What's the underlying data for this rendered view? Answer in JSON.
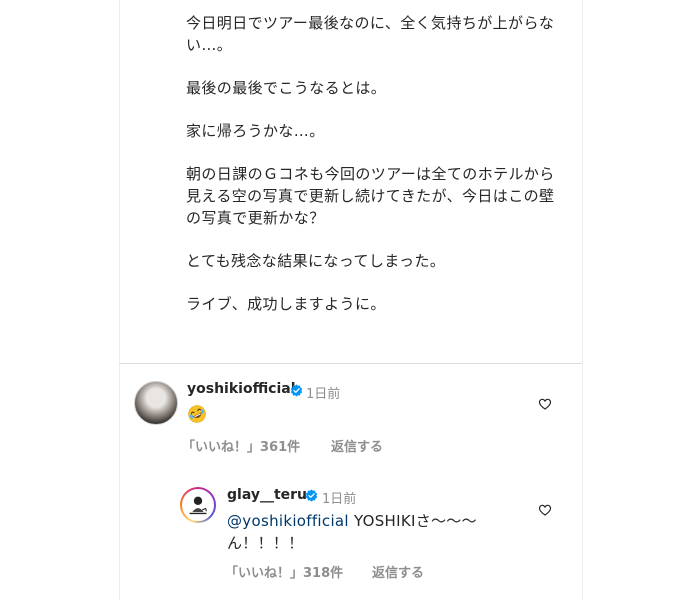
{
  "caption": {
    "paragraphs": [
      "今日明日でツアー最後なのに、全く気持ちが上がらない…。",
      "最後の最後でこうなるとは。",
      "家に帰ろうかな…。",
      "朝の日課のＧコネも今回のツアーは全てのホテルから見える空の写真で更新し続けてきたが、今日はこの壁の写真で更新かな？",
      "とても残念な結果になってしまった。",
      "ライブ、成功しますように。"
    ]
  },
  "comments": [
    {
      "username": "yoshikiofficial",
      "time": "1日前",
      "text_emoji": "rolling-on-floor-laughing-emoji",
      "likes": "「いいね！」361件",
      "reply": "返信する"
    },
    {
      "username": "glay__teru",
      "time": "1日前",
      "mention": "@yoshikiofficial",
      "text_line1": " YOSHIKIさ〜〜〜",
      "text_line2": "ん！！！！",
      "likes": "「いいね！」318件",
      "reply": "返信する"
    }
  ],
  "colors": {
    "text": "#262626",
    "secondary": "#8e8e8e",
    "mention": "#00376b",
    "verified": "#0095f6",
    "divider": "#dbdbdb"
  },
  "icons": [
    "verified-badge-icon",
    "heart-outline-icon",
    "rolling-on-floor-laughing-emoji"
  ]
}
